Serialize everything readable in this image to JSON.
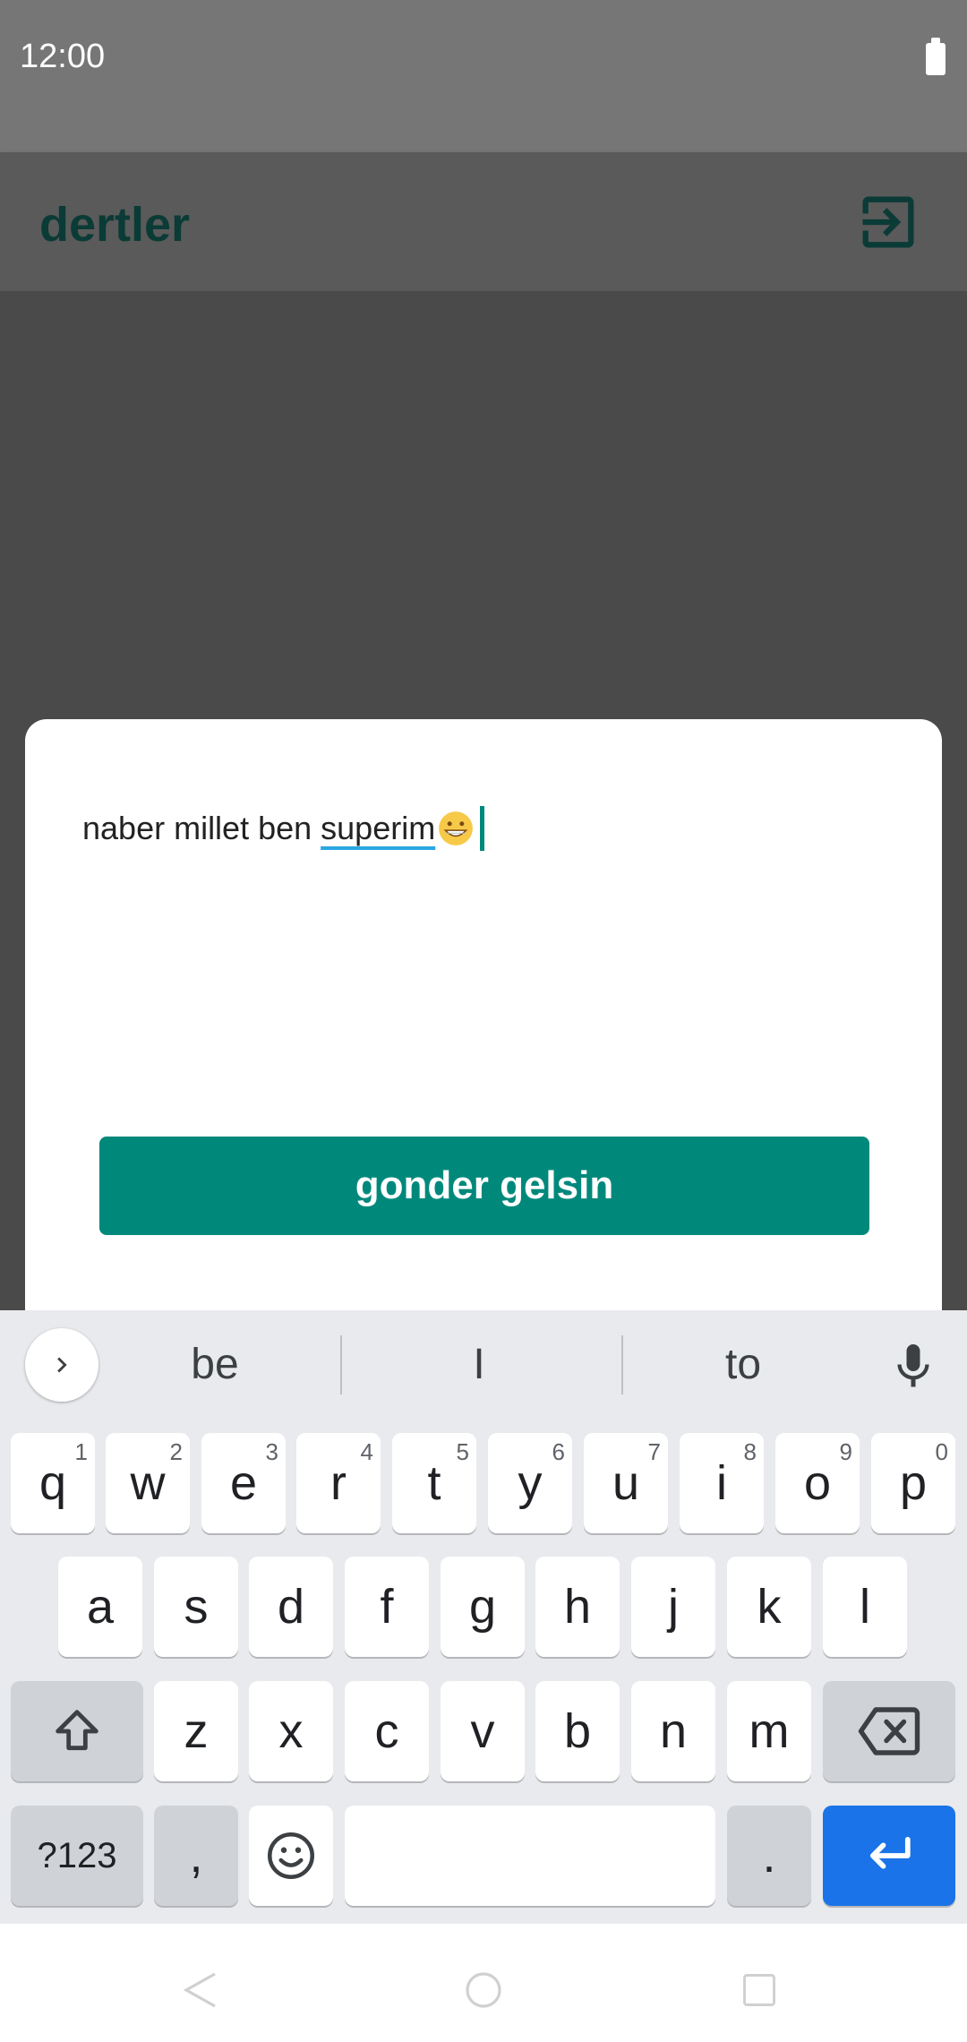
{
  "status_bar": {
    "time": "12:00"
  },
  "app_bar": {
    "title": "dertler",
    "logout_icon": "logout-icon"
  },
  "dialog": {
    "text_plain": "naber millet ben ",
    "text_underlined": "superim",
    "emoji_icon": "grinning-face-icon",
    "send_button_label": "gonder gelsin"
  },
  "keyboard": {
    "suggestions": [
      "be",
      "I",
      "to"
    ],
    "row1": [
      {
        "k": "q",
        "h": "1"
      },
      {
        "k": "w",
        "h": "2"
      },
      {
        "k": "e",
        "h": "3"
      },
      {
        "k": "r",
        "h": "4"
      },
      {
        "k": "t",
        "h": "5"
      },
      {
        "k": "y",
        "h": "6"
      },
      {
        "k": "u",
        "h": "7"
      },
      {
        "k": "i",
        "h": "8"
      },
      {
        "k": "o",
        "h": "9"
      },
      {
        "k": "p",
        "h": "0"
      }
    ],
    "row2": [
      "a",
      "s",
      "d",
      "f",
      "g",
      "h",
      "j",
      "k",
      "l"
    ],
    "row3": [
      "z",
      "x",
      "c",
      "v",
      "b",
      "n",
      "m"
    ],
    "symbols_label": "?123",
    "comma_label": ",",
    "period_label": ".",
    "colors": {
      "enter": "#1a73e8",
      "accent": "#00897b"
    }
  }
}
